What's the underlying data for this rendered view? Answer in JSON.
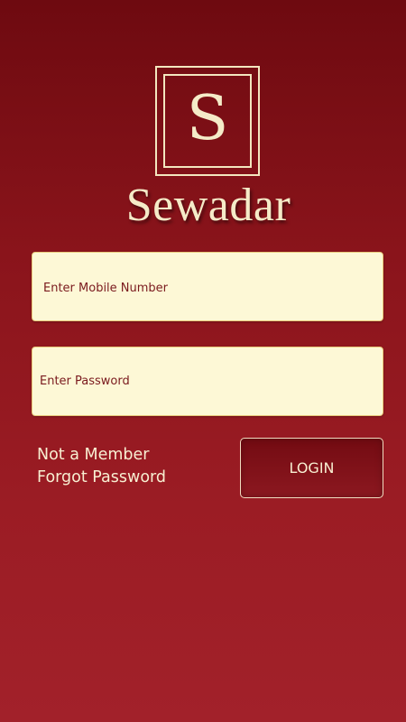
{
  "logo": {
    "letter": "S"
  },
  "app": {
    "name": "Sewadar"
  },
  "form": {
    "mobile_placeholder": "Enter Mobile Number",
    "password_placeholder": "Enter Password",
    "login_label": "LOGIN"
  },
  "links": {
    "not_member": "Not a Member",
    "forgot_password": "Forgot Password"
  },
  "colors": {
    "background_top": "#6e0a10",
    "background_bottom": "#a2212a",
    "accent_cream": "#f5ebc8",
    "field_background": "#fdf8d6",
    "field_text": "#7a1a1e"
  }
}
